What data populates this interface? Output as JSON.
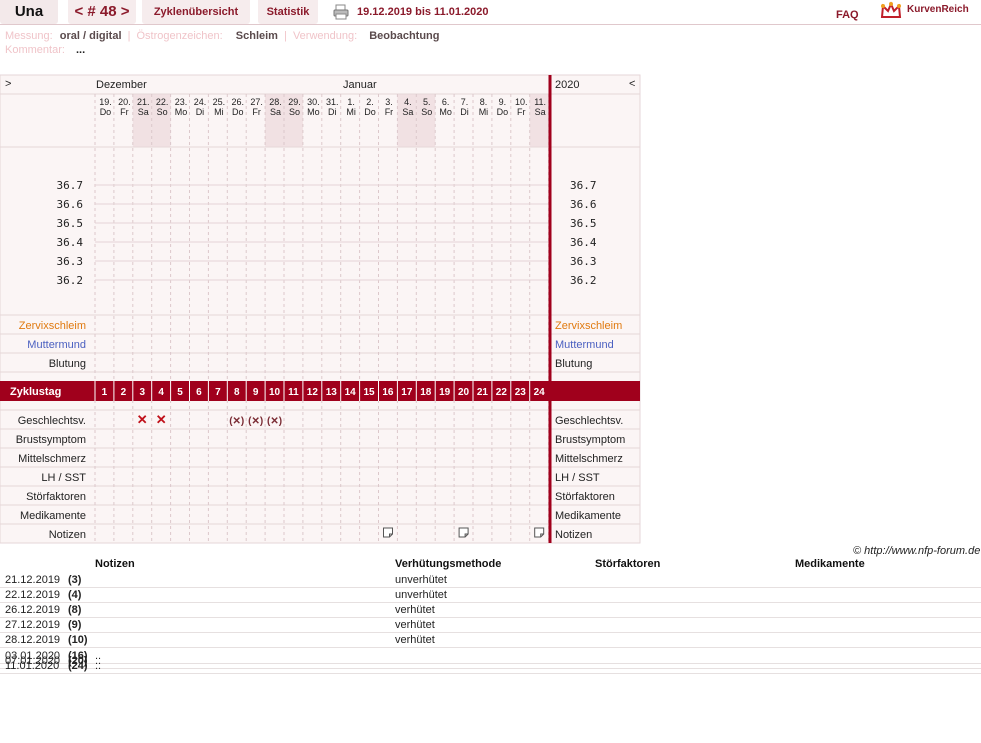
{
  "topbar": {
    "user": "Una",
    "cycle": "< # 48 >",
    "tab_overview": "Zyklenübersicht",
    "tab_stats": "Statistik",
    "range": "19.12.2019 bis 11.01.2020",
    "faq": "FAQ",
    "brand": "KurvenReich"
  },
  "meta": {
    "messung_k": "Messung:",
    "messung_v": "oral / digital",
    "oestro_k": "Östrogenzeichen:",
    "oestro_v": "Schleim",
    "verw_k": "Verwendung:",
    "verw_v": "Beobachtung",
    "komm_k": "Kommentar:",
    "komm_v": "...",
    "sep": "|"
  },
  "chart": {
    "nav_left": ">",
    "nav_right": "<",
    "month1": "Dezember",
    "month2": "Januar",
    "year": "2020",
    "days": [
      {
        "d": "19.",
        "w": "Do"
      },
      {
        "d": "20.",
        "w": "Fr"
      },
      {
        "d": "21.",
        "w": "Sa"
      },
      {
        "d": "22.",
        "w": "So"
      },
      {
        "d": "23.",
        "w": "Mo"
      },
      {
        "d": "24.",
        "w": "Di"
      },
      {
        "d": "25.",
        "w": "Mi"
      },
      {
        "d": "26.",
        "w": "Do"
      },
      {
        "d": "27.",
        "w": "Fr"
      },
      {
        "d": "28.",
        "w": "Sa"
      },
      {
        "d": "29.",
        "w": "So"
      },
      {
        "d": "30.",
        "w": "Mo"
      },
      {
        "d": "31.",
        "w": "Di"
      },
      {
        "d": "1.",
        "w": "Mi"
      },
      {
        "d": "2.",
        "w": "Do"
      },
      {
        "d": "3.",
        "w": "Fr"
      },
      {
        "d": "4.",
        "w": "Sa"
      },
      {
        "d": "5.",
        "w": "So"
      },
      {
        "d": "6.",
        "w": "Mo"
      },
      {
        "d": "7.",
        "w": "Di"
      },
      {
        "d": "8.",
        "w": "Mi"
      },
      {
        "d": "9.",
        "w": "Do"
      },
      {
        "d": "10.",
        "w": "Fr"
      },
      {
        "d": "11.",
        "w": "Sa"
      }
    ],
    "weekend_idx": [
      2,
      3,
      9,
      10,
      16,
      17,
      23
    ],
    "temps": [
      "36.7",
      "36.6",
      "36.5",
      "36.4",
      "36.3",
      "36.2"
    ],
    "rows_top": [
      {
        "label": "Zervixschleim",
        "color": "#e07a10"
      },
      {
        "label": "Muttermund",
        "color": "#4a5fc0"
      },
      {
        "label": "Blutung",
        "color": "#222222"
      }
    ],
    "cycle_label": "Zyklustag",
    "cycle_days": [
      "1",
      "2",
      "3",
      "4",
      "5",
      "6",
      "7",
      "8",
      "9",
      "10",
      "11",
      "12",
      "13",
      "14",
      "15",
      "16",
      "17",
      "18",
      "19",
      "20",
      "21",
      "22",
      "23",
      "24"
    ],
    "rows_bottom": [
      "Geschlechtsv.",
      "Brustsymptom",
      "Mittelschmerz",
      "LH / SST",
      "Störfaktoren",
      "Medikamente",
      "Notizen"
    ],
    "intercourse": [
      {
        "day": 3,
        "mark": "✕"
      },
      {
        "day": 4,
        "mark": "✕"
      },
      {
        "day": 8,
        "mark": "(✕)"
      },
      {
        "day": 9,
        "mark": "(✕)"
      },
      {
        "day": 10,
        "mark": "(✕)"
      }
    ],
    "notes_days": [
      16,
      20,
      24
    ],
    "accent": "#a0001c"
  },
  "copyright": "© http://www.nfp-forum.de",
  "table": {
    "headers": [
      "Notizen",
      "Verhütungsmethode",
      "Störfaktoren",
      "Medikamente"
    ],
    "rows": [
      {
        "date": "21.12.2019",
        "day": "(3)",
        "note": "",
        "method": "unverhütet"
      },
      {
        "date": "22.12.2019",
        "day": "(4)",
        "note": "",
        "method": "unverhütet"
      },
      {
        "date": "26.12.2019",
        "day": "(8)",
        "note": "",
        "method": "verhütet"
      },
      {
        "date": "27.12.2019",
        "day": "(9)",
        "note": "",
        "method": "verhütet"
      },
      {
        "date": "28.12.2019",
        "day": "(10)",
        "note": "",
        "method": "verhütet"
      },
      {
        "date": "03.01.2020",
        "day": "(16)",
        "note": "..",
        "method": ""
      },
      {
        "date": "07.01.2020",
        "day": "(20)",
        "note": "..",
        "method": ""
      },
      {
        "date": "11.01.2020",
        "day": "(24)",
        "note": "..",
        "method": ""
      }
    ]
  }
}
